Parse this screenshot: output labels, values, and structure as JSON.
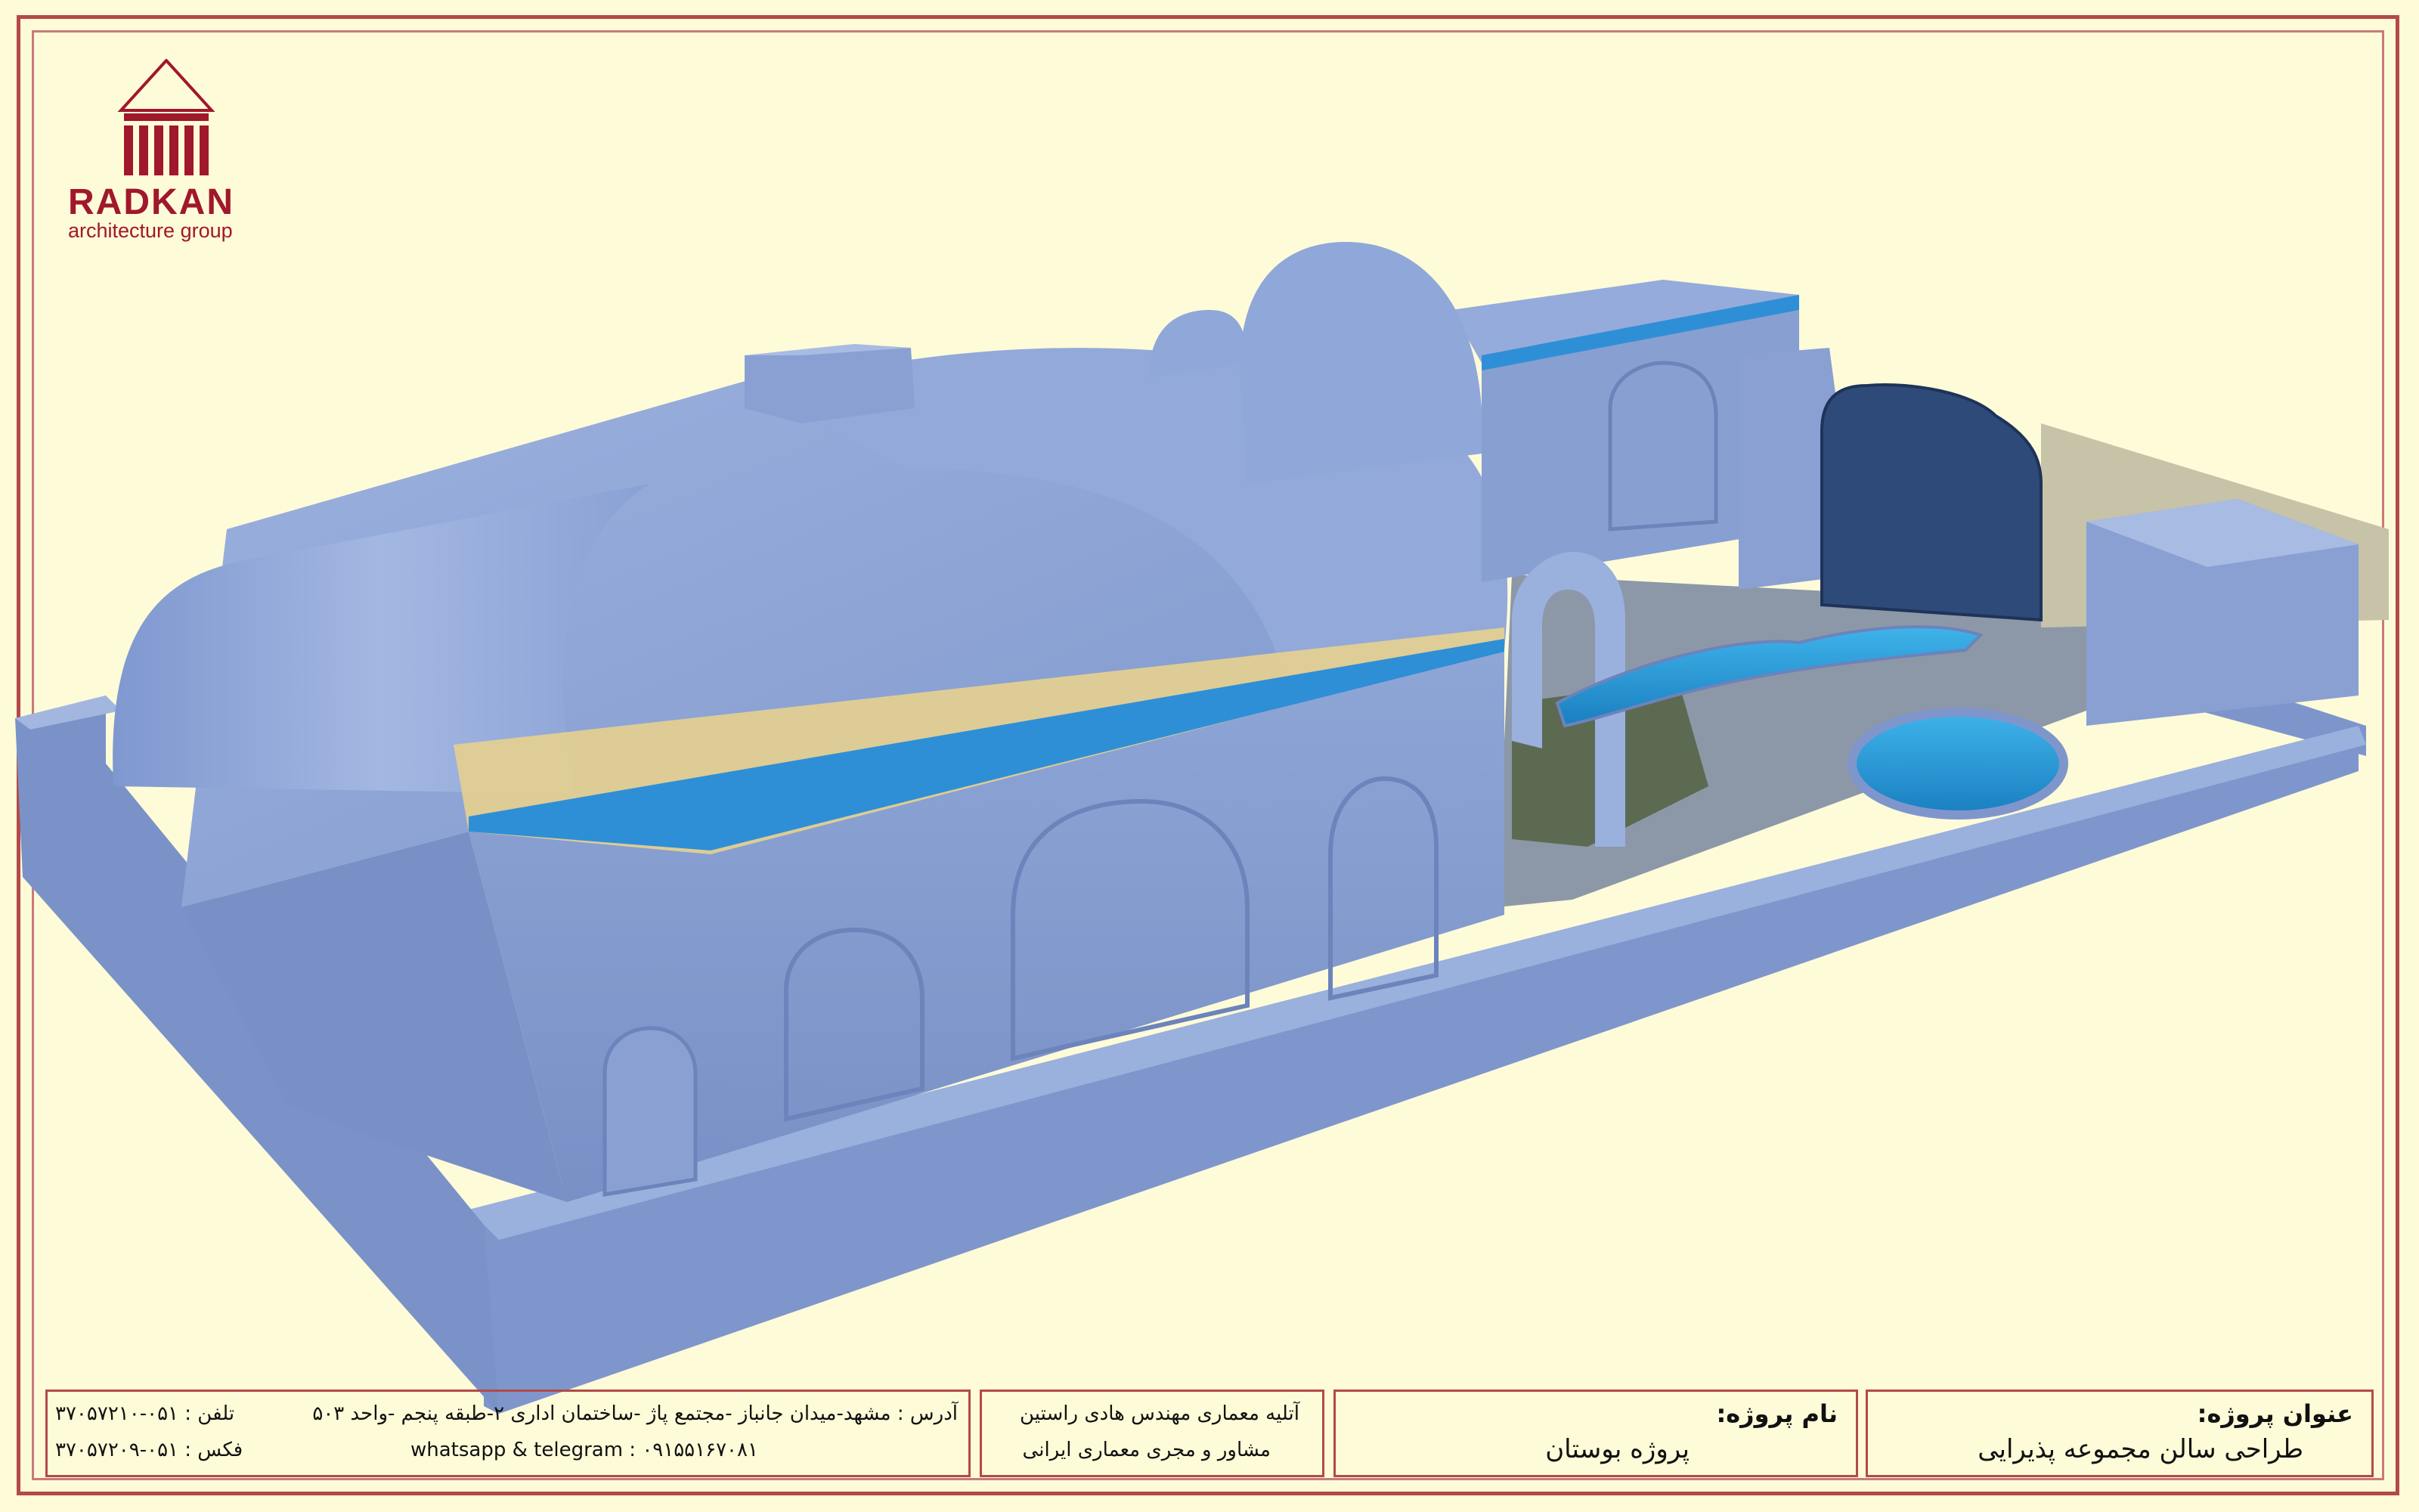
{
  "logo": {
    "name": "RADKAN",
    "subtitle": "architecture group"
  },
  "title_block": {
    "project_title_label": "عنوان پروژه:",
    "project_title_value": "طراحی سالن مجموعه  پذیرایی",
    "project_name_label": "نام پروژه:",
    "project_name_value": "پروژه بوستان",
    "company_line1": "آتلیه معماری مهندس هادی راستین",
    "company_line2": "مشاور و مجری معماری ایرانی",
    "address": "آدرس : مشهد-میدان جانباز -مجتمع پاژ -ساختمان اداری ۲-طبقه پنجم -واحد ۵۰۳",
    "social": "whatsapp & telegram : ۰۹۱۵۵۱۶۷۰۸۱",
    "phone_label": "تلفن :",
    "phone_value": "۰۵۱-۳۷۰۵۷۲۱۰",
    "fax_label": "فکس :",
    "fax_value": "۰۵۱-۳۷۰۵۷۲۰۹"
  },
  "colors": {
    "background": "#fefbd8",
    "frame": "#b34a4a",
    "brand": "#a0182c",
    "building": "#8fa6d4",
    "roof": "#8aa0d2",
    "door": "#2e4a78",
    "pool": "#2d9ad6"
  }
}
